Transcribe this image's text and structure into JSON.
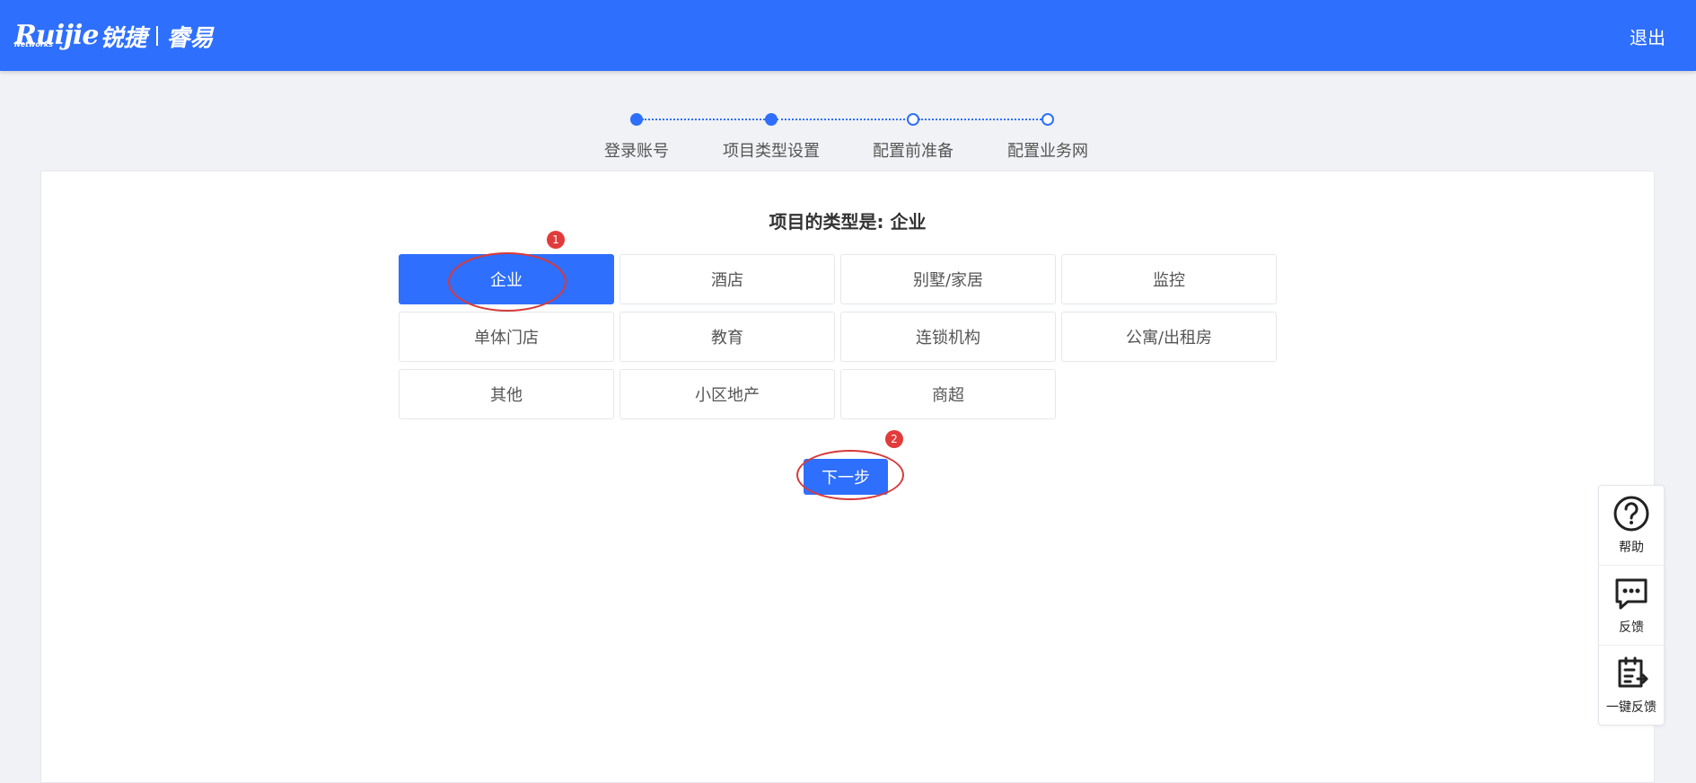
{
  "header": {
    "brand": "Ruijie",
    "brand_sub": "Networks",
    "brand_cn": "锐捷",
    "product": "睿易",
    "logout_label": "退出"
  },
  "steps": [
    {
      "label": "登录账号",
      "state": "done"
    },
    {
      "label": "项目类型设置",
      "state": "done"
    },
    {
      "label": "配置前准备",
      "state": "todo"
    },
    {
      "label": "配置业务网",
      "state": "todo"
    }
  ],
  "project": {
    "title": "项目的类型是: 企业",
    "options": [
      {
        "label": "企业",
        "selected": true
      },
      {
        "label": "酒店",
        "selected": false
      },
      {
        "label": "别墅/家居",
        "selected": false
      },
      {
        "label": "监控",
        "selected": false
      },
      {
        "label": "单体门店",
        "selected": false
      },
      {
        "label": "教育",
        "selected": false
      },
      {
        "label": "连锁机构",
        "selected": false
      },
      {
        "label": "公寓/出租房",
        "selected": false
      },
      {
        "label": "其他",
        "selected": false
      },
      {
        "label": "小区地产",
        "selected": false
      },
      {
        "label": "商超",
        "selected": false
      }
    ],
    "next_label": "下一步"
  },
  "annotations": [
    {
      "number": "1"
    },
    {
      "number": "2"
    }
  ],
  "side_tools": [
    {
      "label": "帮助",
      "icon": "help-icon"
    },
    {
      "label": "反馈",
      "icon": "feedback-icon"
    },
    {
      "label": "一键反馈",
      "icon": "one-click-feedback-icon"
    }
  ],
  "colors": {
    "primary": "#2e6ffd",
    "annotation": "#d83a3a",
    "background": "#f0f2f5"
  }
}
